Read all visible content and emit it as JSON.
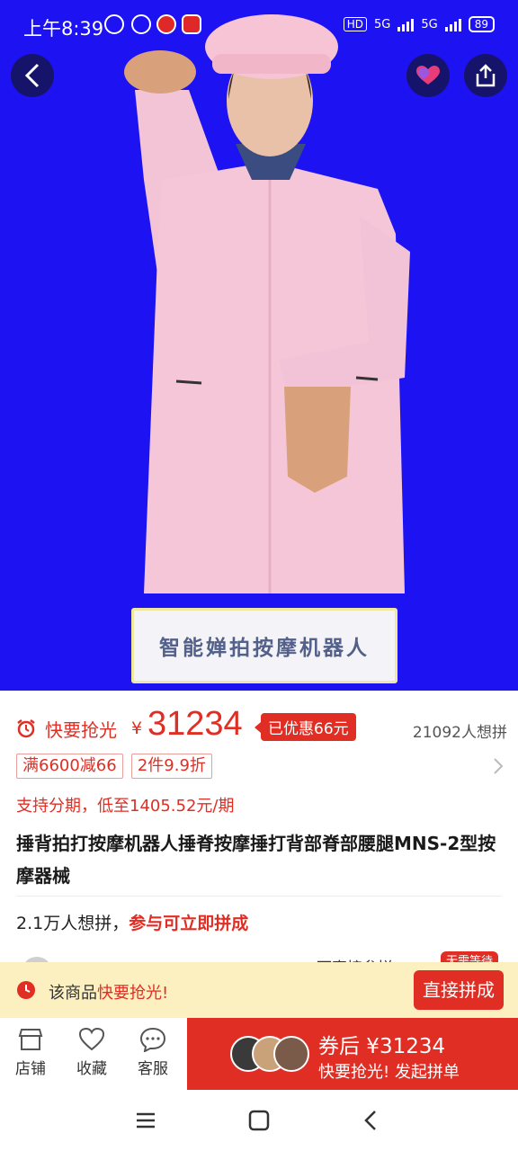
{
  "status_bar": {
    "time": "上午8:39",
    "hd": "HD",
    "net1": "5G",
    "net2": "5G",
    "battery": "89"
  },
  "hero": {
    "sign_text": "智能婵拍按摩机器人"
  },
  "product": {
    "flash_label": "快要抢光",
    "currency": "¥",
    "price": "31234",
    "discount": "已优惠66元",
    "want_count": "21092人想拼",
    "coupons": [
      "满6600减66",
      "2件9.9折"
    ],
    "installment": "支持分期，低至1405.52元/期",
    "title": "捶背拍打按摩机器人捶脊按摩捶打背部脊部腰腿MNS-2型按摩器械"
  },
  "group": {
    "prefix": "2.1万人想拼，",
    "accent": "参与可立即拼成"
  },
  "peek": {
    "text": "可直接参拼",
    "tag": "无需等待"
  },
  "banner": {
    "prefix": "该商品",
    "accent": "快要抢光!",
    "button": "直接拼成"
  },
  "action_bar": {
    "shop": "店铺",
    "favorite": "收藏",
    "service": "客服",
    "buy_price": "券后 ¥31234",
    "buy_sub": "快要抢光! 发起拼单"
  },
  "colors": {
    "accent": "#e02e24",
    "hero_bg": "#1c12f2",
    "banner_bg": "#fcefc0"
  }
}
